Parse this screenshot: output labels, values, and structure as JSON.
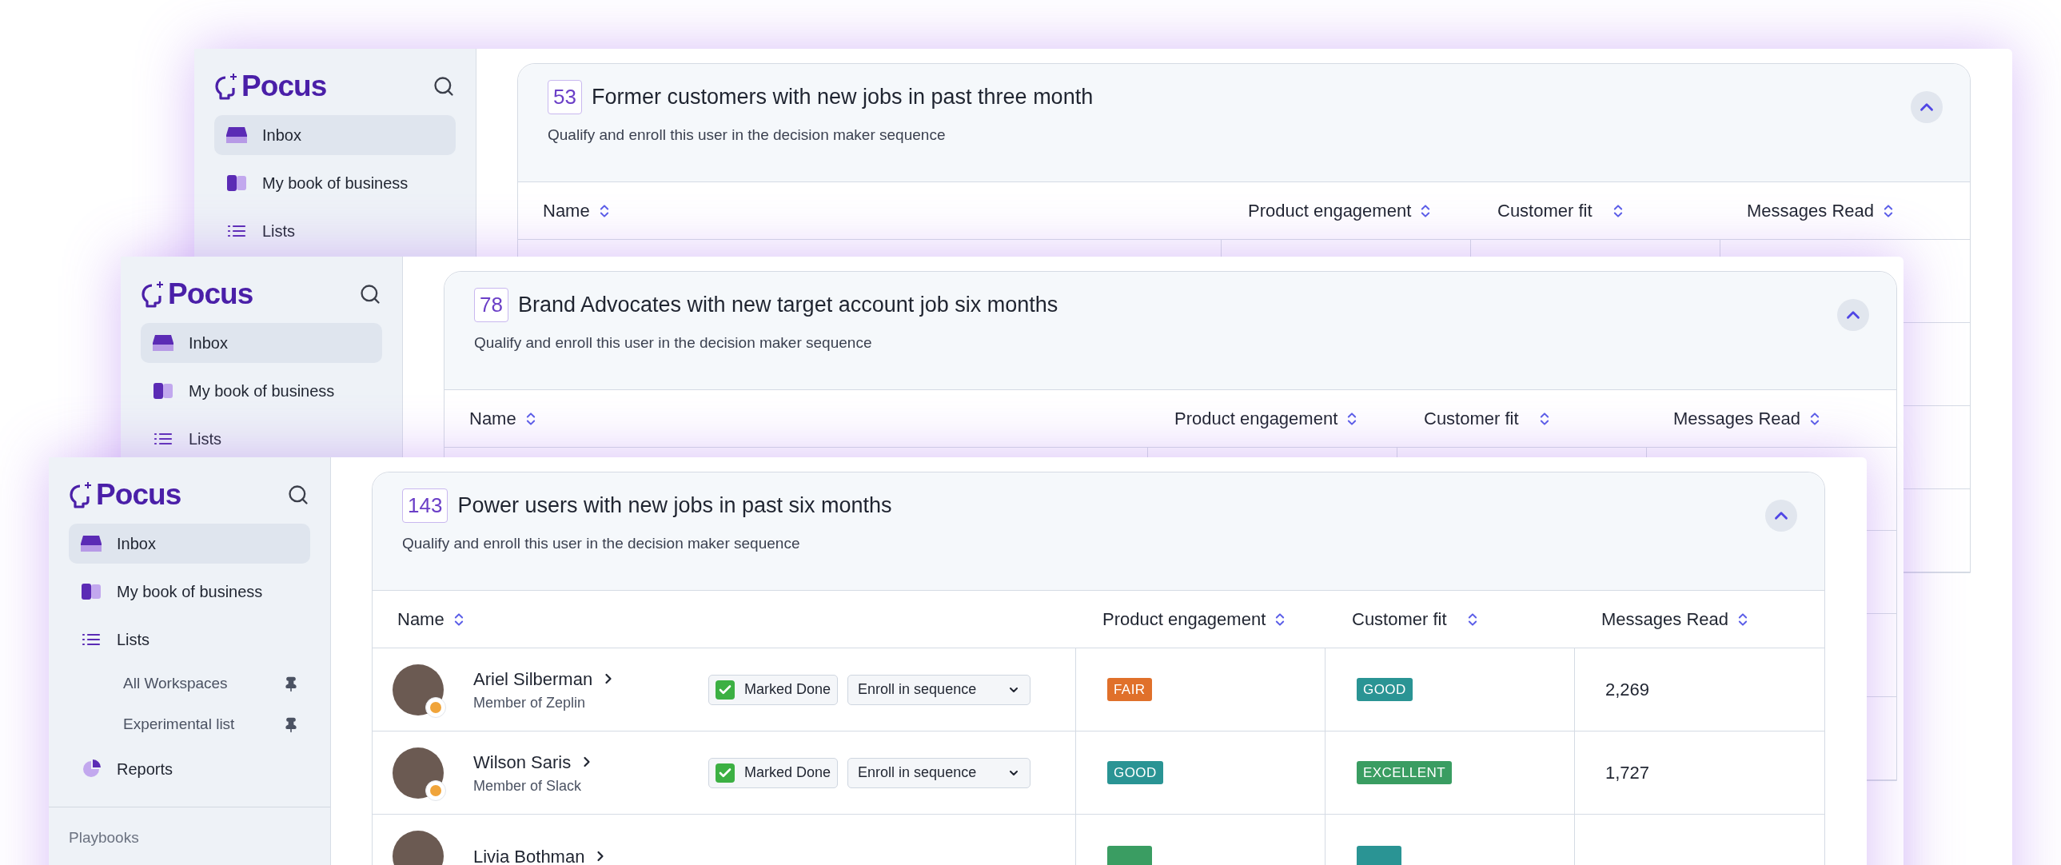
{
  "windows": [
    {
      "sidebar": {
        "logo": "Pocus",
        "nav": [
          {
            "label": "Inbox",
            "selected": true
          },
          {
            "label": "My book of business",
            "selected": false
          },
          {
            "label": "Lists",
            "selected": false
          }
        ]
      },
      "card": {
        "count": "53",
        "title": "Former customers with new jobs in past three month",
        "subtitle": "Qualify and enroll this user in the decision maker sequence",
        "expanded": true,
        "columns": [
          "Name",
          "Product engagement",
          "Customer fit",
          "Messages Read"
        ]
      }
    },
    {
      "sidebar": {
        "logo": "Pocus",
        "nav": [
          {
            "label": "Inbox",
            "selected": true
          },
          {
            "label": "My book of business",
            "selected": false
          },
          {
            "label": "Lists",
            "selected": false
          }
        ]
      },
      "card": {
        "count": "78",
        "title": "Brand Advocates with new target account job six months",
        "subtitle": "Qualify and enroll this user in the decision maker sequence",
        "expanded": true,
        "columns": [
          "Name",
          "Product engagement",
          "Customer fit",
          "Messages Read"
        ]
      }
    },
    {
      "sidebar": {
        "logo": "Pocus",
        "nav": [
          {
            "label": "Inbox",
            "selected": true
          },
          {
            "label": "My book of business",
            "selected": false
          },
          {
            "label": "Lists",
            "selected": false,
            "children": [
              {
                "label": "All Workspaces"
              },
              {
                "label": "Experimental list"
              }
            ]
          },
          {
            "label": "Reports",
            "selected": false
          }
        ],
        "section": "Playbooks"
      },
      "card": {
        "count": "143",
        "title": "Power users with new jobs in past six months",
        "subtitle": "Qualify and enroll this user in the decision maker sequence",
        "expanded": true,
        "columns": [
          "Name",
          "Product engagement",
          "Customer fit",
          "Messages Read"
        ],
        "rows": [
          {
            "name": "Ariel Silberman",
            "org": "Member of Zeplin",
            "done": "Marked Done",
            "action": "Enroll in sequence",
            "engagement": {
              "label": "FAIR",
              "color": "#e0702b"
            },
            "fit": {
              "label": "GOOD",
              "color": "#2a9494"
            },
            "messages": "2,269"
          },
          {
            "name": "Wilson Saris",
            "org": "Member of Slack",
            "done": "Marked Done",
            "action": "Enroll in sequence",
            "engagement": {
              "label": "GOOD",
              "color": "#2a9494"
            },
            "fit": {
              "label": "EXCELLENT",
              "color": "#3a9d62"
            },
            "messages": "1,727"
          },
          {
            "name": "Livia Bothman",
            "engagement": {
              "color": "#3a9d62"
            },
            "fit": {
              "color": "#2a9494"
            }
          }
        ]
      }
    }
  ]
}
